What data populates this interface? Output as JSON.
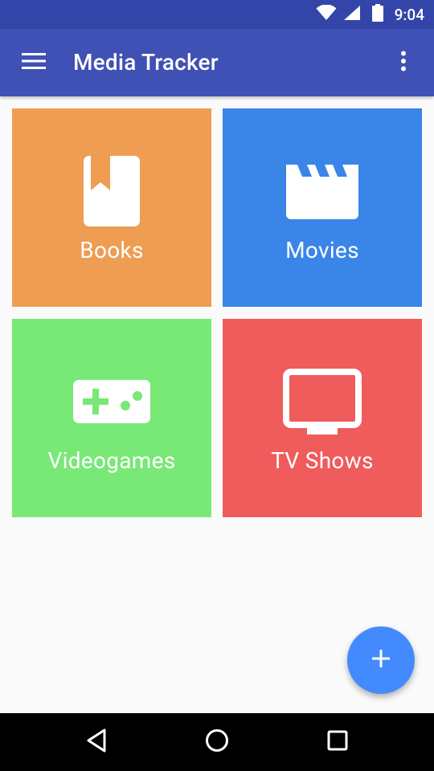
{
  "status_bar": {
    "time": "9:04",
    "icons": [
      "wifi-icon",
      "cell-signal-icon",
      "battery-icon"
    ]
  },
  "app_bar": {
    "title": "Media Tracker",
    "menu_icon": "hamburger-menu-icon",
    "overflow_icon": "more-vert-icon",
    "color": "#3f51b5"
  },
  "categories": [
    {
      "label": "Books",
      "icon": "book-icon",
      "color": "#ee9d52"
    },
    {
      "label": "Movies",
      "icon": "clapperboard-icon",
      "color": "#3a85e8"
    },
    {
      "label": "Videogames",
      "icon": "gamepad-icon",
      "color": "#78e876"
    },
    {
      "label": "TV Shows",
      "icon": "tv-icon",
      "color": "#f05b5b"
    }
  ],
  "fab": {
    "icon": "plus-icon",
    "color": "#448aff"
  },
  "nav_bar": {
    "buttons": [
      "back-icon",
      "home-icon",
      "recents-icon"
    ]
  }
}
